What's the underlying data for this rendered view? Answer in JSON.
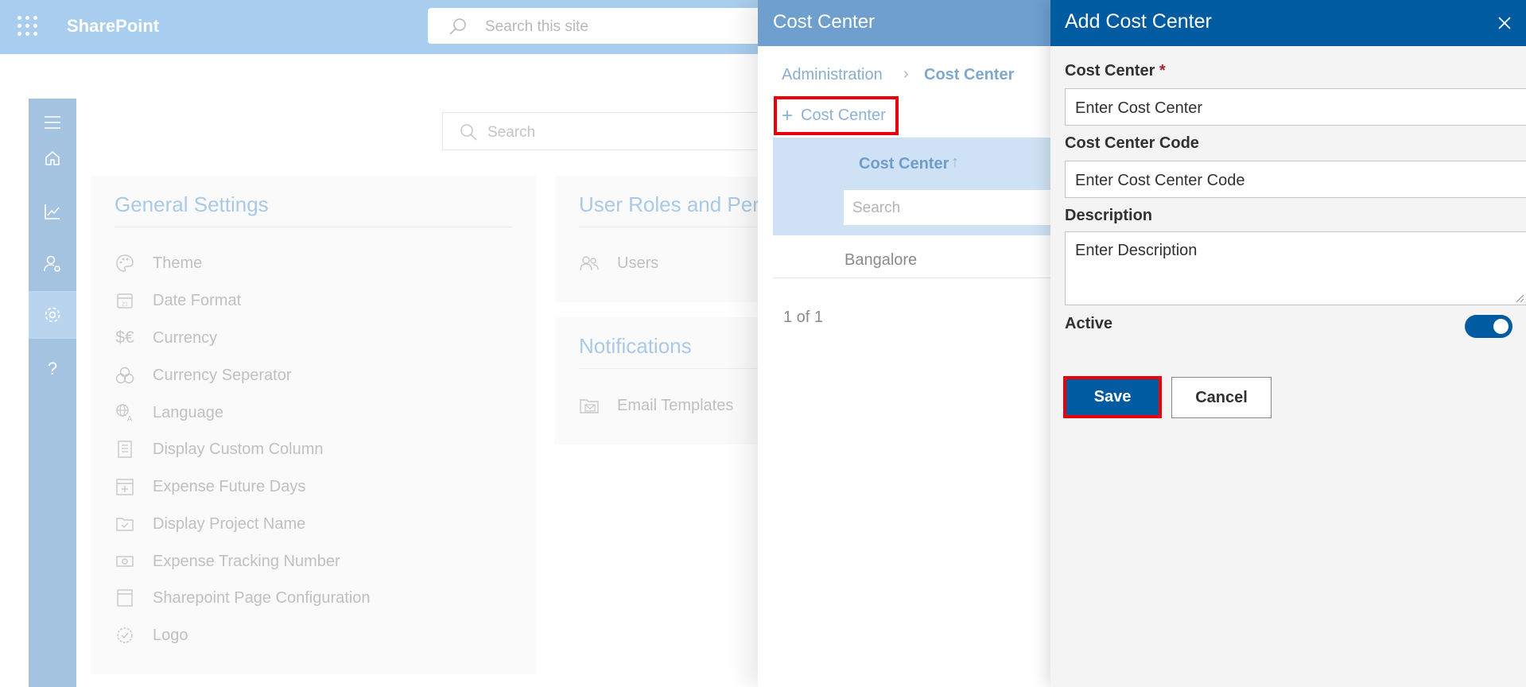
{
  "topbar": {
    "brand": "SharePoint",
    "search_placeholder": "Search this site"
  },
  "rail": {
    "items": [
      "menu",
      "home",
      "analytics",
      "user-settings",
      "settings",
      "help"
    ],
    "help_glyph": "?"
  },
  "page": {
    "search_placeholder": "Search",
    "general_settings": {
      "title": "General Settings",
      "items": [
        {
          "label": "Theme",
          "icon": "palette-icon"
        },
        {
          "label": "Date Format",
          "icon": "calendar-icon"
        },
        {
          "label": "Currency",
          "icon": "currency-icon"
        },
        {
          "label": "Currency Seperator",
          "icon": "coins-icon"
        },
        {
          "label": "Language",
          "icon": "language-icon"
        },
        {
          "label": "Display Custom Column",
          "icon": "document-icon"
        },
        {
          "label": "Expense Future Days",
          "icon": "calendar-add-icon"
        },
        {
          "label": "Display Project Name",
          "icon": "folder-check-icon"
        },
        {
          "label": "Expense Tracking Number",
          "icon": "money-icon"
        },
        {
          "label": "Sharepoint Page Configuration",
          "icon": "page-icon"
        },
        {
          "label": "Logo",
          "icon": "badge-check-icon"
        }
      ]
    },
    "user_roles": {
      "title": "User Roles and Permissions",
      "items": [
        {
          "label": "Users",
          "icon": "people-icon"
        }
      ]
    },
    "notifications": {
      "title": "Notifications",
      "items": [
        {
          "label": "Email Templates",
          "icon": "mail-folder-icon"
        }
      ]
    }
  },
  "mid_panel": {
    "title": "Cost Center",
    "breadcrumb": [
      "Administration",
      "Cost Center"
    ],
    "breadcrumb_sep": "›",
    "add_button": {
      "plus": "+",
      "label": "Cost Center"
    },
    "column_header": "Cost Center",
    "sort_arrow": "↑",
    "column_search_placeholder": "Search",
    "rows": [
      "Bangalore"
    ],
    "pager": "1 of 1"
  },
  "form_panel": {
    "title": "Add Cost Center",
    "cost_center": {
      "label": "Cost Center",
      "required_mark": "*",
      "placeholder": "Enter Cost Center"
    },
    "cost_center_code": {
      "label": "Cost Center Code",
      "placeholder": "Enter Cost Center Code"
    },
    "description": {
      "label": "Description",
      "placeholder": "Enter Description"
    },
    "active": {
      "label": "Active",
      "value": true
    },
    "save_label": "Save",
    "cancel_label": "Cancel"
  },
  "colors": {
    "brand_blue": "#005ba1",
    "topbar": "#a9cdee",
    "highlight_red": "#e8000b"
  }
}
